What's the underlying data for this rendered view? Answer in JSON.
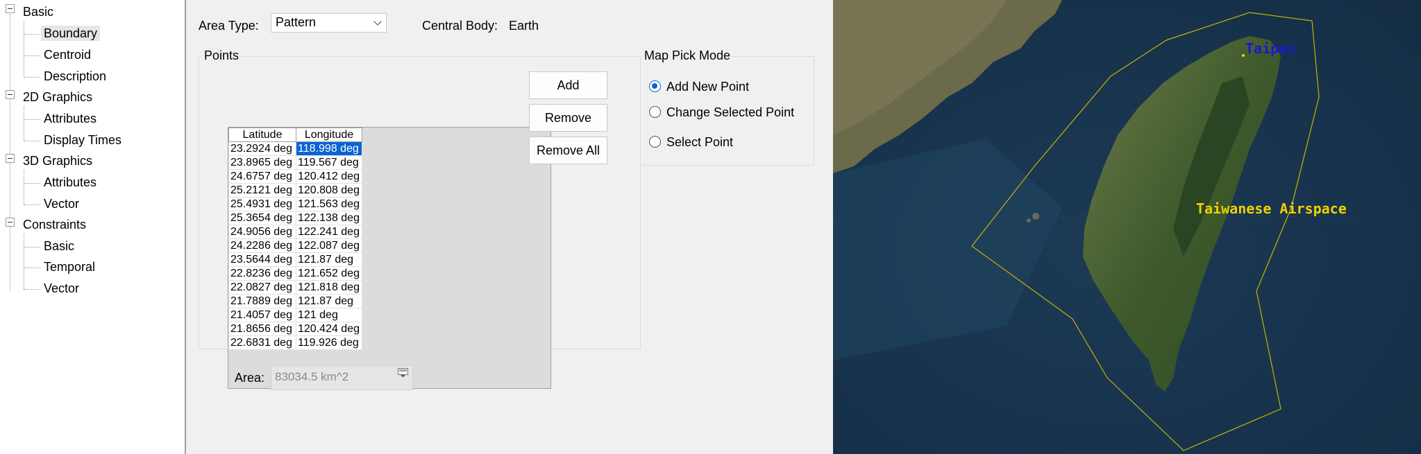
{
  "tree": {
    "groups": [
      {
        "label": "Basic",
        "children": [
          "Boundary",
          "Centroid",
          "Description"
        ]
      },
      {
        "label": "2D Graphics",
        "children": [
          "Attributes",
          "Display Times"
        ]
      },
      {
        "label": "3D Graphics",
        "children": [
          "Attributes",
          "Vector"
        ]
      },
      {
        "label": "Constraints",
        "children": [
          "Basic",
          "Temporal",
          "Vector"
        ]
      }
    ],
    "selected": "Boundary"
  },
  "props": {
    "area_type_label": "Area Type:",
    "area_type_value": "Pattern",
    "central_body_label": "Central Body:",
    "central_body_value": "Earth",
    "points_title": "Points",
    "columns": [
      "Latitude",
      "Longitude"
    ],
    "rows": [
      [
        "23.2924 deg",
        "118.998 deg"
      ],
      [
        "23.8965 deg",
        "119.567 deg"
      ],
      [
        "24.6757 deg",
        "120.412 deg"
      ],
      [
        "25.2121 deg",
        "120.808 deg"
      ],
      [
        "25.4931 deg",
        "121.563 deg"
      ],
      [
        "25.3654 deg",
        "122.138 deg"
      ],
      [
        "24.9056 deg",
        "122.241 deg"
      ],
      [
        "24.2286 deg",
        "122.087 deg"
      ],
      [
        "23.5644 deg",
        "121.87 deg"
      ],
      [
        "22.8236 deg",
        "121.652 deg"
      ],
      [
        "22.0827 deg",
        "121.818 deg"
      ],
      [
        "21.7889 deg",
        "121.87 deg"
      ],
      [
        "21.4057 deg",
        "121 deg"
      ],
      [
        "21.8656 deg",
        "120.424 deg"
      ],
      [
        "22.6831 deg",
        "119.926 deg"
      ]
    ],
    "buttons": {
      "add": "Add",
      "remove": "Remove",
      "remove_all": "Remove All"
    },
    "map_pick": {
      "title": "Map Pick Mode",
      "options": [
        "Add New Point",
        "Change Selected Point",
        "Select Point"
      ],
      "selected": "Add New Point"
    },
    "area_label": "Area:",
    "area_value": "83034.5 km^2"
  },
  "map": {
    "labels": {
      "city": "Taipei",
      "region": "Taiwanese Airspace"
    },
    "colors": {
      "city_label": "#1a1acc",
      "region_label": "#f0d000",
      "boundary": "#c8b400"
    }
  }
}
